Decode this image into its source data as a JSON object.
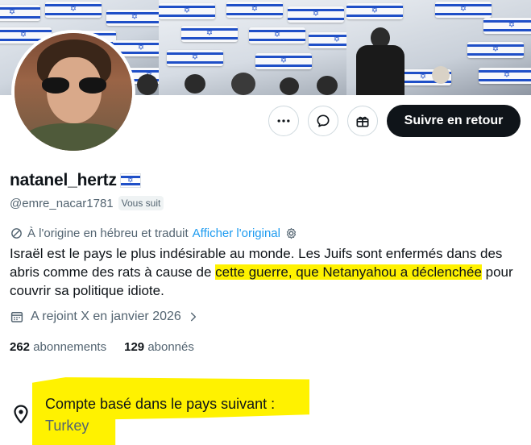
{
  "profile": {
    "display_name": "natanel_hertz",
    "flag_emoji": "✡",
    "handle": "@emre_nacar1781",
    "follows_you": "Vous suit"
  },
  "actions": {
    "more_icon": "more-dots-icon",
    "message_icon": "message-bubble-icon",
    "gift_icon": "gift-icon",
    "follow_back_label": "Suivre en retour"
  },
  "translation": {
    "notice": "À l'origine en hébreu et traduit",
    "show_original": "Afficher l'original"
  },
  "bio": {
    "part1": "Israël est le pays le plus indésirable au monde. Les Juifs sont enfermés dans des abris comme des rats à cause de ",
    "highlighted": "cette guerre, que Netanyahou a déclenchée",
    "part2": " pour couvrir sa politique idiote."
  },
  "joined": "A rejoint X en janvier 2026",
  "stats": {
    "following_count": "262",
    "following_label": "abonnements",
    "followers_count": "129",
    "followers_label": "abonnés"
  },
  "location": {
    "title": "Compte basé dans le pays suivant :",
    "country": "Turkey"
  },
  "colors": {
    "highlight": "#fff200",
    "link": "#1d9bf0",
    "follow_button": "#0f1419",
    "secondary_text": "#536471"
  }
}
